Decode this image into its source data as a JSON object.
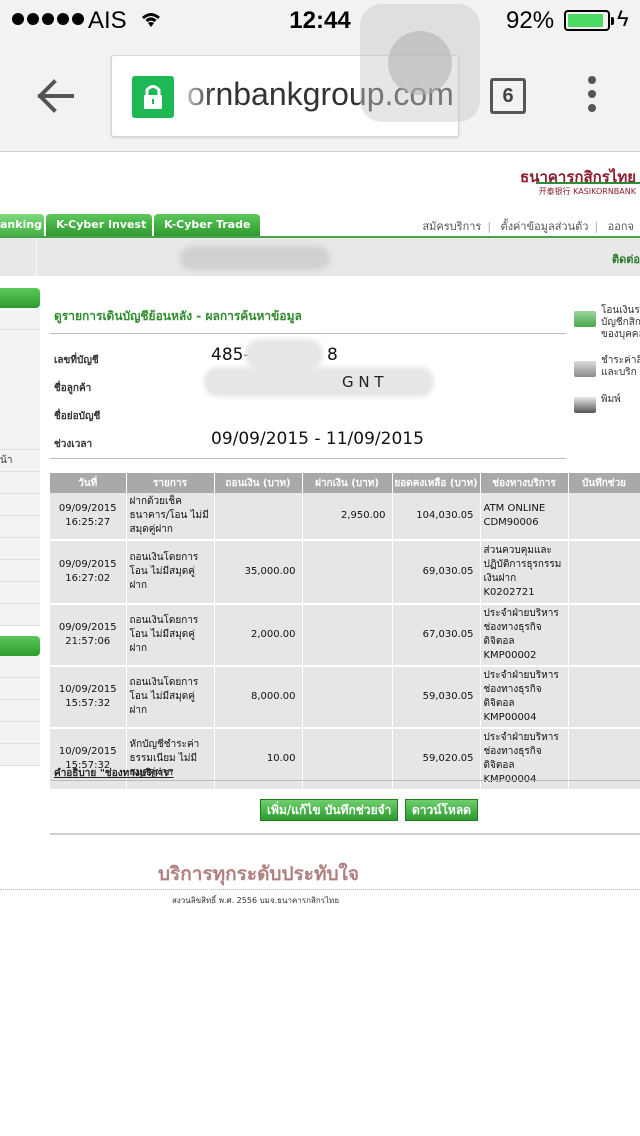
{
  "status_bar": {
    "carrier": "AIS",
    "time": "12:44",
    "battery": "92%",
    "battery_level": 0.92
  },
  "browser": {
    "url": "ornbankgroup.com",
    "tab_count": "6"
  },
  "bank": {
    "logo_th": "ธนาคารกสิกรไทย",
    "logo_en": "开泰银行 KASIKORNBANK",
    "nav_tabs": [
      "anking",
      "K-Cyber Invest",
      "K-Cyber Trade"
    ],
    "top_links": [
      "สมัครบริการ",
      "ตั้งค่าข้อมูลส่วนตัว",
      "ออกจ"
    ],
    "contact": "ติดต่อ",
    "left_nav_text": "น้า"
  },
  "main": {
    "title": "ดูรายการเดินบัญชีย้อนหลัง - ผลการค้นหาข้อมูล",
    "labels": {
      "account_no": "เลขที่บัญชี",
      "customer_name": "ชื่อลูกค้า",
      "account_name": "ชื่อย่อบัญชี",
      "period": "ช่วงเวลา"
    },
    "values": {
      "account_no_start": "485-",
      "account_no_end": "8",
      "customer_name_fragments": "G     N   T",
      "period": "09/09/2015 - 11/09/2015"
    },
    "side_links": [
      {
        "text": "โอนเงินระ\nบัญชีกสิก\nของบุคคล",
        "icon": "transfer-icon"
      },
      {
        "text": "ชำระค่าสิ\nและบริก",
        "icon": "payment-icon"
      },
      {
        "text": "พิมพ์",
        "icon": "printer-icon"
      }
    ]
  },
  "table": {
    "headers": [
      "วันที่",
      "รายการ",
      "ถอนเงิน (บาท)",
      "ฝากเงิน (บาท)",
      "ยอดคงเหลือ (บาท)",
      "ช่องทางบริการ",
      "บันทึกช่วย"
    ],
    "rows": [
      {
        "date": "09/09/2015",
        "time": "16:25:27",
        "desc": "ฝากด้วยเช็ค ธนาคาร/โอน ไม่มีสมุดคู่ฝาก",
        "withdraw": "",
        "deposit": "2,950.00",
        "balance": "104,030.05",
        "channel": "ATM ONLINE CDM90006",
        "note": ""
      },
      {
        "date": "09/09/2015",
        "time": "16:27:02",
        "desc": "ถอนเงินโดยการโอน ไม่มีสมุดคู่ฝาก",
        "withdraw": "35,000.00",
        "deposit": "",
        "balance": "69,030.05",
        "channel": "ส่วนควบคุมและปฏิบัติการธุรกรรมเงินฝาก K0202721",
        "note": ""
      },
      {
        "date": "09/09/2015",
        "time": "21:57:06",
        "desc": "ถอนเงินโดยการโอน ไม่มีสมุดคู่ฝาก",
        "withdraw": "2,000.00",
        "deposit": "",
        "balance": "67,030.05",
        "channel": "ประจำฝ่ายบริหารช่องทางธุรกิจดิจิตอล KMP00002",
        "note": ""
      },
      {
        "date": "10/09/2015",
        "time": "15:57:32",
        "desc": "ถอนเงินโดยการโอน ไม่มีสมุดคู่ฝาก",
        "withdraw": "8,000.00",
        "deposit": "",
        "balance": "59,030.05",
        "channel": "ประจำฝ่ายบริหารช่องทางธุรกิจดิจิตอล KMP00004",
        "note": ""
      },
      {
        "date": "10/09/2015",
        "time": "15:57:32",
        "desc": "หักบัญชีชำระค่าธรรมเนียม ไม่มีสมุดคู่ฝาก",
        "withdraw": "10.00",
        "deposit": "",
        "balance": "59,020.05",
        "channel": "ประจำฝ่ายบริหารช่องทางธุรกิจดิจิตอล KMP00004",
        "note": ""
      }
    ]
  },
  "footer": {
    "legend_link": "คำอธิบาย \"ช่องทางบริการ\"",
    "buttons": [
      "เพิ่ม/แก้ไข บันทึกช่วยจำ",
      "ดาวน์โหลด"
    ],
    "slogan": "บริการทุกระดับประทับใจ",
    "copyright": "สงวนลิขสิทธิ์ พ.ศ. 2556 บมจ.ธนาคารกสิกรไทย"
  },
  "colors": {
    "accent_green": "#2e9a2e",
    "brand_red": "#8b1d2c",
    "table_header": "#a9a9a9"
  }
}
